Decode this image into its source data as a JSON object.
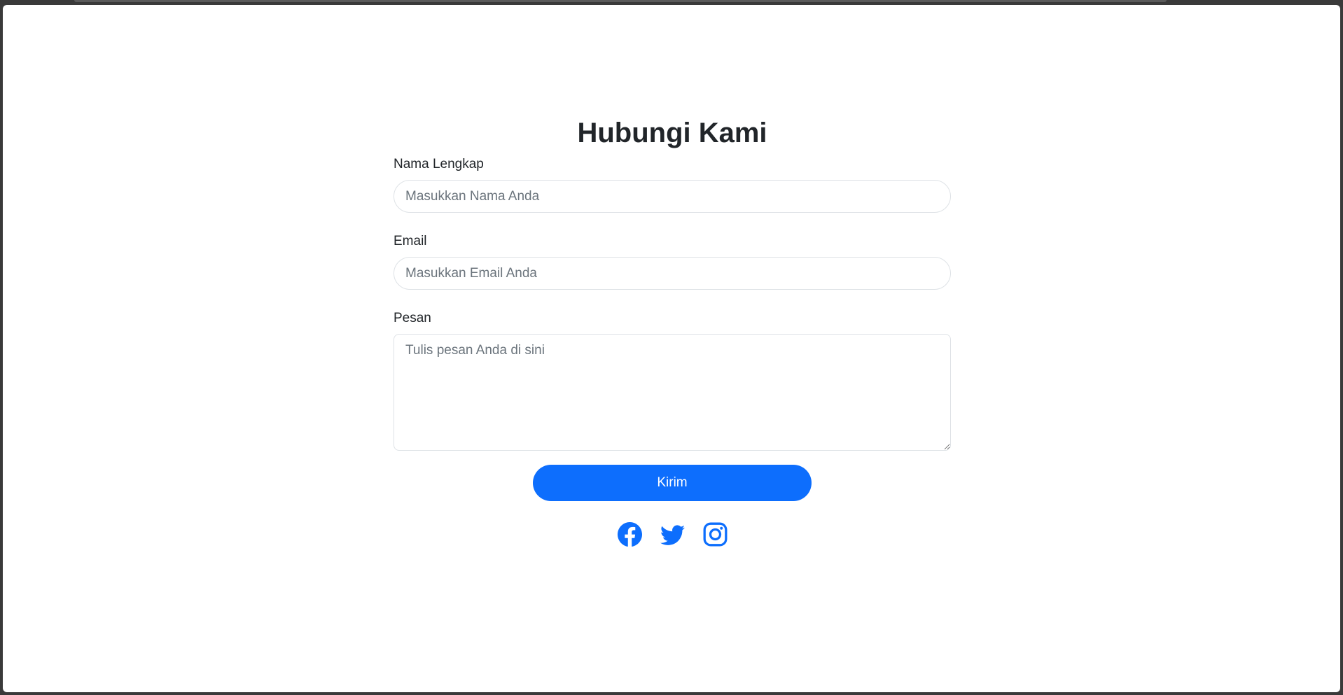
{
  "page": {
    "title": "Hubungi Kami"
  },
  "form": {
    "name_label": "Nama Lengkap",
    "name_placeholder": "Masukkan Nama Anda",
    "email_label": "Email",
    "email_placeholder": "Masukkan Email Anda",
    "message_label": "Pesan",
    "message_placeholder": "Tulis pesan Anda di sini",
    "submit_label": "Kirim"
  },
  "social": {
    "icons": [
      "facebook-icon",
      "twitter-icon",
      "instagram-icon"
    ]
  },
  "colors": {
    "accent": "#0d6efd",
    "text": "#212529",
    "placeholder": "#6c757d",
    "border": "#dee2e6"
  }
}
